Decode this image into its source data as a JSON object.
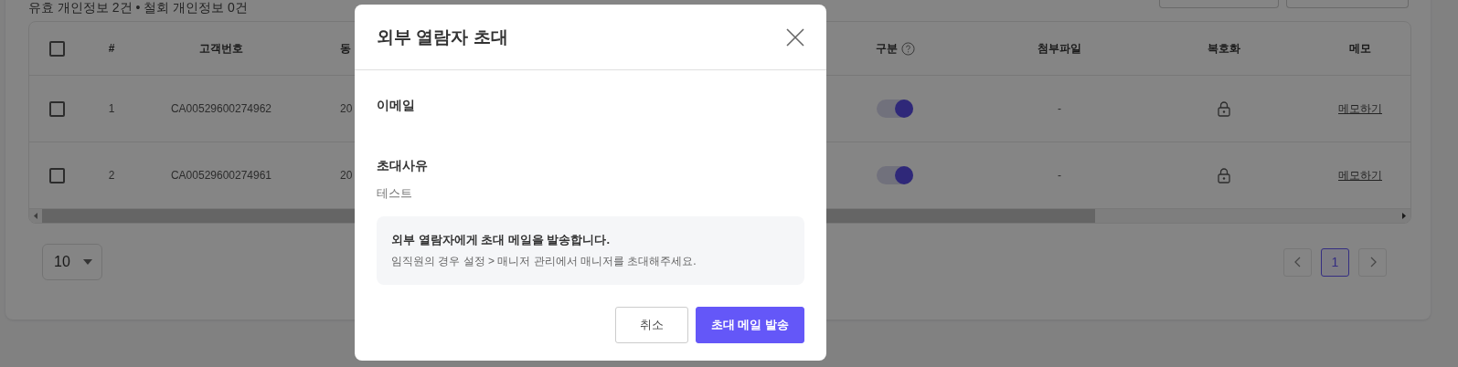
{
  "summary": "유효 개인정보 2건 • 철회 개인정보 0건",
  "table": {
    "select_all_checked": false,
    "columns": [
      {
        "label": "#",
        "help": false
      },
      {
        "label": "고객번호",
        "help": false
      },
      {
        "label": "동",
        "help": false
      },
      {
        "label": "구분",
        "help": true
      },
      {
        "label": "첨부파일",
        "help": false
      },
      {
        "label": "복호화",
        "help": false
      },
      {
        "label": "메모",
        "help": false
      }
    ],
    "rows": [
      {
        "checked": false,
        "index": "1",
        "customer_no": "CA00529600274962",
        "column_3": "20",
        "on": true,
        "attachment": "-",
        "locked": true,
        "memo": "메모하기"
      },
      {
        "checked": false,
        "index": "2",
        "customer_no": "CA00529600274961",
        "column_3": "20",
        "on": true,
        "attachment": "-",
        "locked": true,
        "memo": "메모하기"
      }
    ]
  },
  "page_size": "10",
  "pagination": [
    {
      "label": "1",
      "selected": true
    }
  ],
  "modal": {
    "title": "외부 열람자 초대",
    "fields": [
      {
        "label": "이메일"
      },
      {
        "label": "초대사유",
        "value": "테스트"
      }
    ],
    "notice": {
      "title": "외부 열람자에게 초대 메일을 발송합니다.",
      "text": "임직원의 경우 설정 > 매니저 관리에서 매니저를 초대해주세요."
    },
    "buttons": [
      {
        "label": "취소",
        "kind": "secondary"
      },
      {
        "label": "초대 메일 발송",
        "kind": "primary"
      }
    ]
  }
}
